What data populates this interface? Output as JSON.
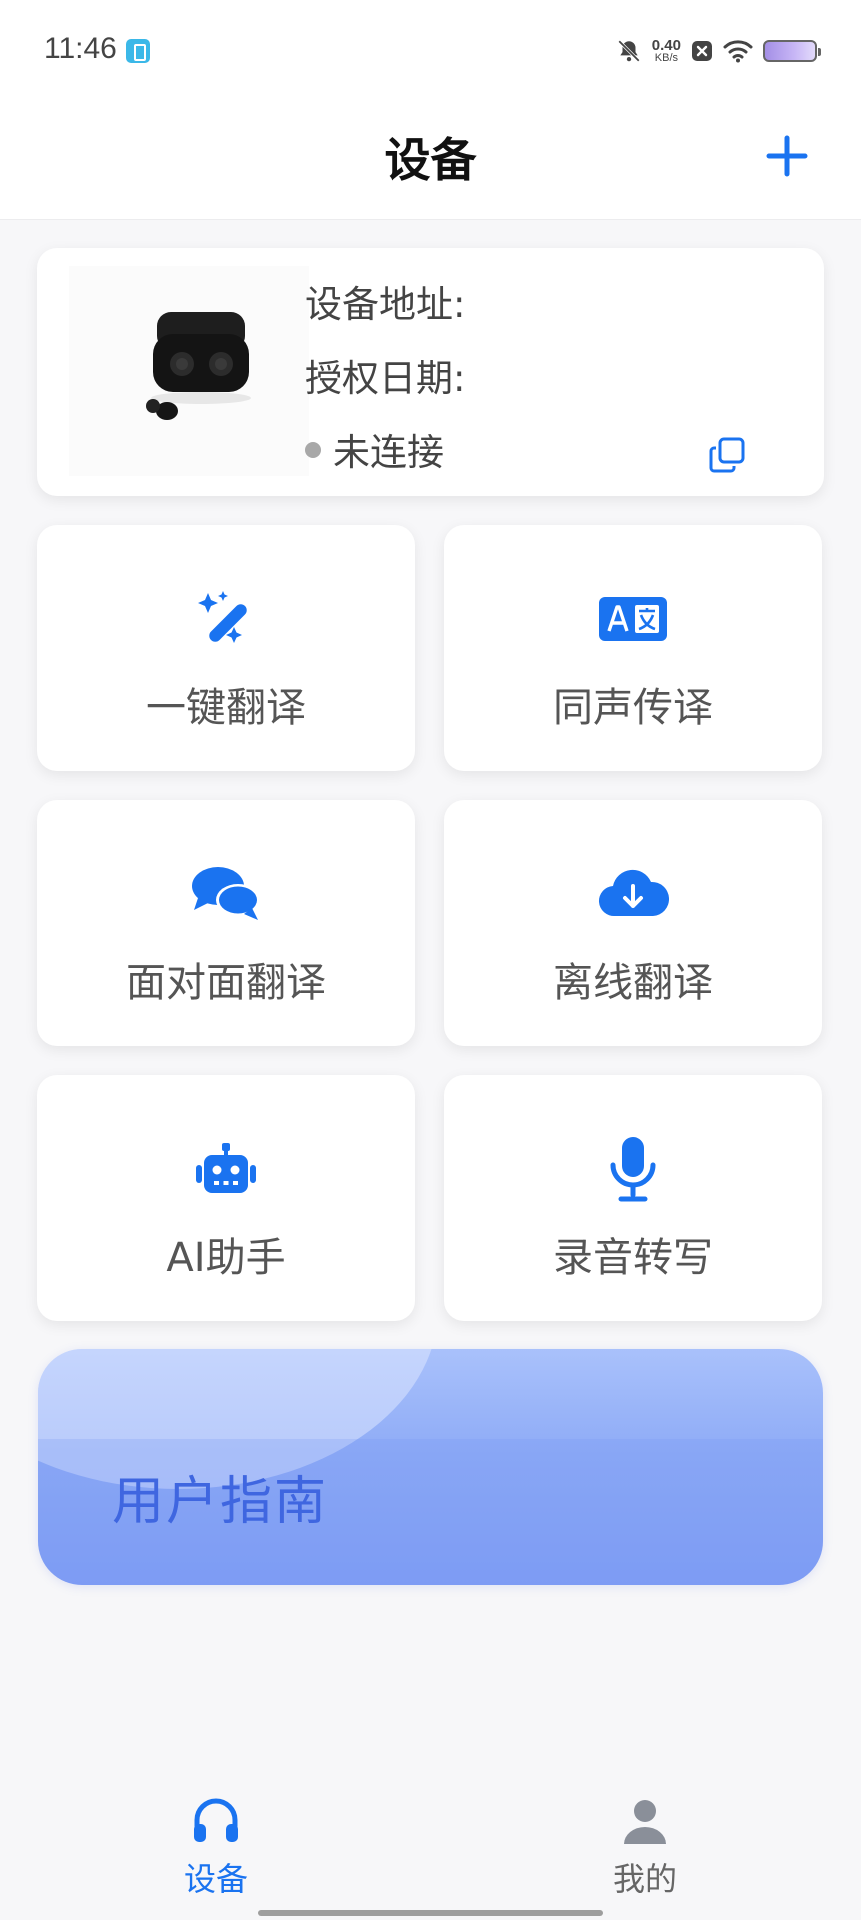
{
  "status_bar": {
    "time": "11:46",
    "net_speed_value": "0.40",
    "net_speed_unit": "KB/s",
    "icons": [
      "app-badge-icon",
      "mute-icon",
      "close-box-icon",
      "wifi-icon",
      "battery-icon"
    ]
  },
  "header": {
    "title": "设备",
    "add_icon": "plus-icon"
  },
  "device": {
    "address_label": "设备地址:",
    "date_label": "授权日期:",
    "status": "未连接",
    "status_color": "#a8a8a8"
  },
  "features": [
    {
      "label": "一键翻译",
      "icon": "magic-wand-icon"
    },
    {
      "label": "同声传译",
      "icon": "translate-icon"
    },
    {
      "label": "面对面翻译",
      "icon": "chat-bubbles-icon"
    },
    {
      "label": "离线翻译",
      "icon": "cloud-download-icon"
    },
    {
      "label": "AI助手",
      "icon": "robot-icon"
    },
    {
      "label": "录音转写",
      "icon": "microphone-icon"
    }
  ],
  "banner": {
    "label": "用户指南"
  },
  "tabs": [
    {
      "label": "设备",
      "icon": "headphones-icon",
      "active": true
    },
    {
      "label": "我的",
      "icon": "person-icon",
      "active": false
    }
  ],
  "colors": {
    "accent": "#1a73f0",
    "inactive_tab": "#8a8f99"
  }
}
